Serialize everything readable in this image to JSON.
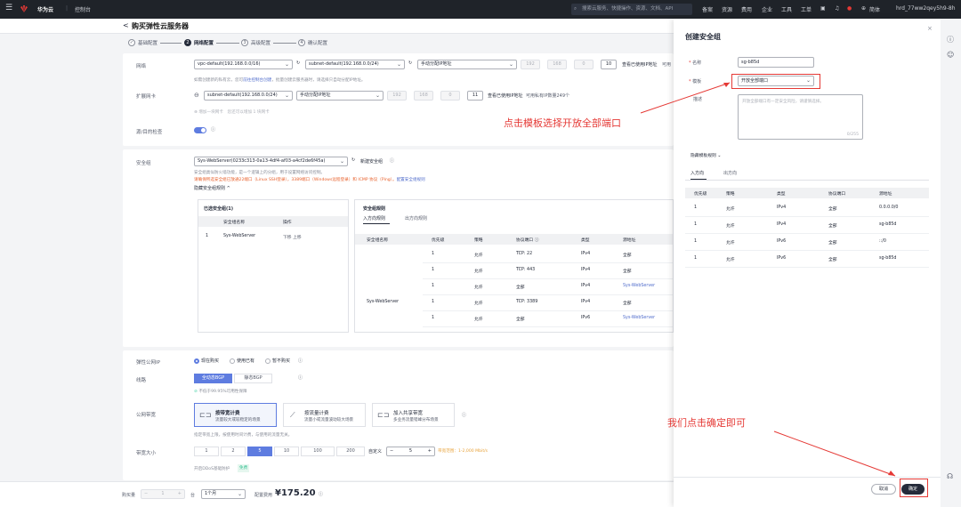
{
  "topbar": {
    "brand": "华为云",
    "console": "控制台",
    "search_placeholder": "搜索云服务、快捷操作、资源、文档、API",
    "nav": [
      "备案",
      "资源",
      "费用",
      "企业",
      "工具",
      "工单"
    ],
    "lang": "简体",
    "user": "hrd_77ww2qey5h9-8h"
  },
  "page": {
    "title": "购买弹性云服务器",
    "back": "<"
  },
  "steps": [
    {
      "num": "✓",
      "label": "基础配置"
    },
    {
      "num": "2",
      "label": "网络配置"
    },
    {
      "num": "3",
      "label": "高级配置"
    },
    {
      "num": "4",
      "label": "确认配置"
    }
  ],
  "network": {
    "label": "网络",
    "vpc": "vpc-default(192.168.0.0/16)",
    "subnet": "subnet-default(192.168.0.0/24)",
    "ip_mode": "手动分配IP地址",
    "ip_parts": [
      "192",
      "168",
      "0",
      "10"
    ],
    "check_link": "查看已使用IP地址",
    "avail_prefix": "可用",
    "hint": "如需创建新的私有云，您可",
    "hint_link": "前往控制台创建",
    "hint_tail": "，批量创建云服务器时，请选择只自动分配IP地址。"
  },
  "ext_nic": {
    "label": "扩展网卡",
    "subnet": "subnet-default(192.168.0.0/24)",
    "ip_mode": "手动分配IP地址",
    "ip_parts": [
      "192",
      "168",
      "0",
      "11"
    ],
    "check_link": "查看已使用IP地址",
    "avail": "可用私有IP数量249个",
    "add": "增加一块网卡",
    "add_tail": "您还可以增加 1 块网卡"
  },
  "src_dst": {
    "label": "源/目的检查"
  },
  "secgroup": {
    "label": "安全组",
    "selected": "Sys-WebServer(0233c313-0a13-4df4-af03-a4cf2de6f45a)",
    "create_link": "新建安全组",
    "hint1": "安全组类似防火墙功能，是一个逻辑上的分组，用于设置网络访问控制。",
    "hint2": "请确保所选安全组已放通22端口（Linux SSH登录），3389端口（Windows远程登录）和 ICMP 协议（Ping）。",
    "hint2_link": "配置安全组规则",
    "collapse": "隐藏安全组规则 ^",
    "selected_title": "已选安全组(1)",
    "sel_cols": [
      "安全组名称",
      "操作"
    ],
    "sel_rows": [
      {
        "idx": "1",
        "name": "Sys-WebServer",
        "ops": "下移  上移"
      }
    ],
    "rules_title": "安全组规则",
    "tabs": [
      "入方向规则",
      "出方向规则"
    ],
    "cols": [
      "安全组名称",
      "优先级",
      "策略",
      "协议端口 ⓘ",
      "类型",
      "源地址"
    ],
    "group_name": "Sys-WebServer",
    "rows": [
      {
        "prio": "1",
        "policy": "允许",
        "port": "TCP: 22",
        "type": "IPv4",
        "src": "全部"
      },
      {
        "prio": "1",
        "policy": "允许",
        "port": "TCP: 443",
        "type": "IPv4",
        "src": "全部"
      },
      {
        "prio": "1",
        "policy": "允许",
        "port": "全部",
        "type": "IPv4",
        "src": "Sys-WebServer"
      },
      {
        "prio": "1",
        "policy": "允许",
        "port": "TCP: 3389",
        "type": "IPv4",
        "src": "全部"
      },
      {
        "prio": "1",
        "policy": "允许",
        "port": "全部",
        "type": "IPv6",
        "src": "Sys-WebServer"
      }
    ]
  },
  "eip": {
    "label": "弹性公网IP",
    "options": [
      "现在购买",
      "使用已有",
      "暂不购买"
    ],
    "line_label": "线路",
    "lines": [
      "全动态BGP",
      "静态BGP"
    ],
    "sla": "不低于99.95%可用性保障",
    "billing_label": "公网带宽",
    "billing": [
      {
        "title": "按带宽计费",
        "sub": "流量较大或较稳定的场景"
      },
      {
        "title": "按流量计费",
        "sub": "流量小或流量波动较大场景"
      },
      {
        "title": "加入共享带宽",
        "sub": "多业务流量错峰分布场景"
      }
    ],
    "billing_hint": "指定带宽上限，按使用时间计费，与使用的流量无关。",
    "bw_label": "带宽大小",
    "bw_opts": [
      "1",
      "2",
      "5",
      "10",
      "100",
      "200"
    ],
    "custom": "自定义",
    "custom_val": "5",
    "custom_range": "带宽范围：1-2,000 Mbit/s",
    "ddos": "开启DDoS基础防护",
    "ddos_tag": "免费"
  },
  "footer": {
    "qty_label": "购买量",
    "qty": "1",
    "unit": "台",
    "duration": "1个月",
    "price_label": "配置费用",
    "price": "¥175.20",
    "info": "ⓘ"
  },
  "panel": {
    "title": "创建安全组",
    "name_label": "名称",
    "name_value": "sg-b85d",
    "tpl_label": "模板",
    "tpl_value": "开放全部端口",
    "desc_label": "描述",
    "desc_placeholder": "开放全部端口有一定安全风险，请谨慎选择。",
    "desc_count": "0/255",
    "rules_toggle": "隐藏模板规则",
    "tabs": [
      "入方向",
      "出方向"
    ],
    "cols": [
      "优先级",
      "策略",
      "类型",
      "协议端口",
      "源地址"
    ],
    "rows": [
      {
        "prio": "1",
        "policy": "允许",
        "type": "IPv4",
        "port": "全部",
        "src": "0.0.0.0/0"
      },
      {
        "prio": "1",
        "policy": "允许",
        "type": "IPv4",
        "port": "全部",
        "src": "sg-b85d"
      },
      {
        "prio": "1",
        "policy": "允许",
        "type": "IPv6",
        "port": "全部",
        "src": "::/0"
      },
      {
        "prio": "1",
        "policy": "允许",
        "type": "IPv6",
        "port": "全部",
        "src": "sg-b85d"
      }
    ],
    "cancel": "取消",
    "ok": "确定"
  },
  "annotations": {
    "tpl_tip": "点击模板选择开放全部端口",
    "ok_tip": "我们点击确定即可"
  },
  "colors": {
    "primary": "#5e7ce0",
    "annotation": "#e53935",
    "topbar": "#1f2329"
  }
}
